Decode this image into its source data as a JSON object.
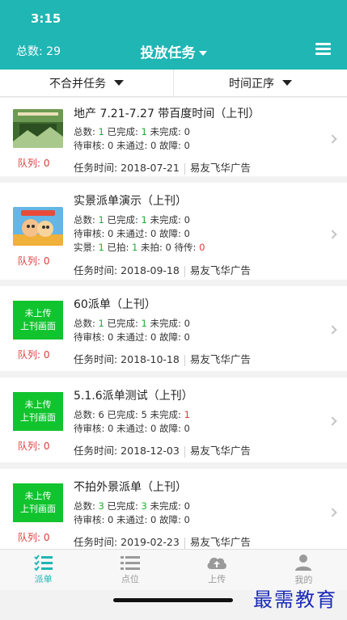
{
  "status_bar": {
    "time": "3:15"
  },
  "header": {
    "total": "总数: 29",
    "title": "投放任务"
  },
  "filters": [
    {
      "label": "不合并任务"
    },
    {
      "label": "时间正序"
    }
  ],
  "tasks": [
    {
      "title": "地产 7.21-7.27 带百度时间（上刊）",
      "queue": "队列: 0",
      "total_label": "总数: ",
      "total": "1",
      "done_label": " 已完成: ",
      "done": "1",
      "undone_label": " 未完成: ",
      "undone": "0",
      "line2": "待审核: 0 未通过: 0 故障: 0",
      "time": "任务时间: 2018-07-21",
      "company": "易友飞华广告"
    },
    {
      "title": "实景派单演示（上刊）",
      "queue": "队列: 0",
      "total_label": "总数: ",
      "total": "1",
      "done_label": " 已完成: ",
      "done": "1",
      "undone_label": " 未完成: ",
      "undone": "0",
      "line2": "待审核: 0 未通过: 0 故障: 0",
      "line3": {
        "a_label": "实景: ",
        "a": "1",
        "b_label": " 已拍: ",
        "b": "1",
        "c": " 未拍: 0 待传: ",
        "d": "0"
      },
      "time": "任务时间: 2018-09-18",
      "company": "易友飞华广告"
    },
    {
      "title": "60派单（上刊）",
      "queue": "队列: 0",
      "badge": [
        "未上传",
        "上刊画面"
      ],
      "total_label": "总数: ",
      "total": "1",
      "done_label": " 已完成: ",
      "done": "1",
      "undone_label": " 未完成: ",
      "undone": "0",
      "line2": "待审核: 0 未通过: 0 故障: 0",
      "time": "任务时间: 2018-10-18",
      "company": "易友飞华广告"
    },
    {
      "title": "5.1.6派单测试（上刊）",
      "queue": "队列: 0",
      "badge": [
        "未上传",
        "上刊画面"
      ],
      "total_label": "总数: ",
      "total": "6",
      "done_label": " 已完成: ",
      "done": "5",
      "undone_label": " 未完成: ",
      "undone": "1",
      "line2": "待审核: 0 未通过: 0 故障: 0",
      "time": "任务时间: 2018-12-03",
      "company": "易友飞华广告"
    },
    {
      "title": "不拍外景派单（上刊）",
      "queue": "队列: 0",
      "badge": [
        "未上传",
        "上刊画面"
      ],
      "total_label": "总数: ",
      "total": "3",
      "done_label": " 已完成: ",
      "done": "3",
      "undone_label": " 未完成: ",
      "undone": "0",
      "line2": "待审核: 0 未通过: 0 故障: 0",
      "time": "任务时间: 2019-02-23",
      "company": "易友飞华广告"
    }
  ],
  "tabbar": [
    {
      "label": "派单",
      "icon": "checklist-icon"
    },
    {
      "label": "点位",
      "icon": "list-icon"
    },
    {
      "label": "上传",
      "icon": "cloud-upload-icon"
    },
    {
      "label": "我的",
      "icon": "user-icon"
    }
  ],
  "watermark": "最需教育",
  "colors": {
    "primary": "#1fb6b4",
    "success": "#1fae2e",
    "danger": "#e13a3a",
    "badge": "#11c42e"
  }
}
